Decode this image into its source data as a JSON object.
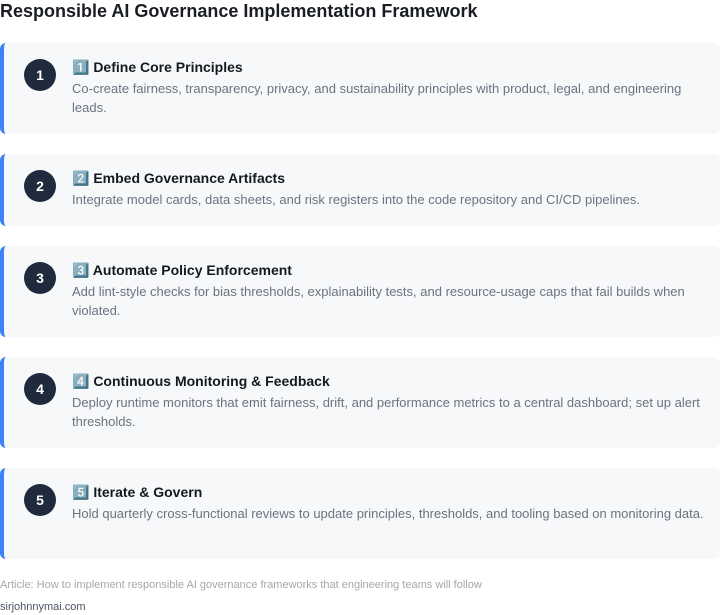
{
  "title": "Responsible AI Governance Implementation Framework",
  "steps": [
    {
      "number": "1",
      "title": "1️⃣ Define Core Principles",
      "description": "Co-create fairness, transparency, privacy, and sustainability principles with product, legal, and engineering leads."
    },
    {
      "number": "2",
      "title": "2️⃣ Embed Governance Artifacts",
      "description": "Integrate model cards, data sheets, and risk registers into the code repository and CI/CD pipelines."
    },
    {
      "number": "3",
      "title": "3️⃣ Automate Policy Enforcement",
      "description": "Add lint-style checks for bias thresholds, explainability tests, and resource-usage caps that fail builds when violated."
    },
    {
      "number": "4",
      "title": "4️⃣ Continuous Monitoring & Feedback",
      "description": "Deploy runtime monitors that emit fairness, drift, and performance metrics to a central dashboard; set up alert thresholds."
    },
    {
      "number": "5",
      "title": "5️⃣ Iterate & Govern",
      "description": "Hold quarterly cross-functional reviews to update principles, thresholds, and tooling based on monitoring data."
    }
  ],
  "footnote": "Article: How to implement responsible AI governance frameworks that engineering teams will follow",
  "credit": "sirjohnnymai.com",
  "colors": {
    "accent": "#3b82f6",
    "badge": "#1f2a3c",
    "card_bg": "#f7f8fa"
  }
}
